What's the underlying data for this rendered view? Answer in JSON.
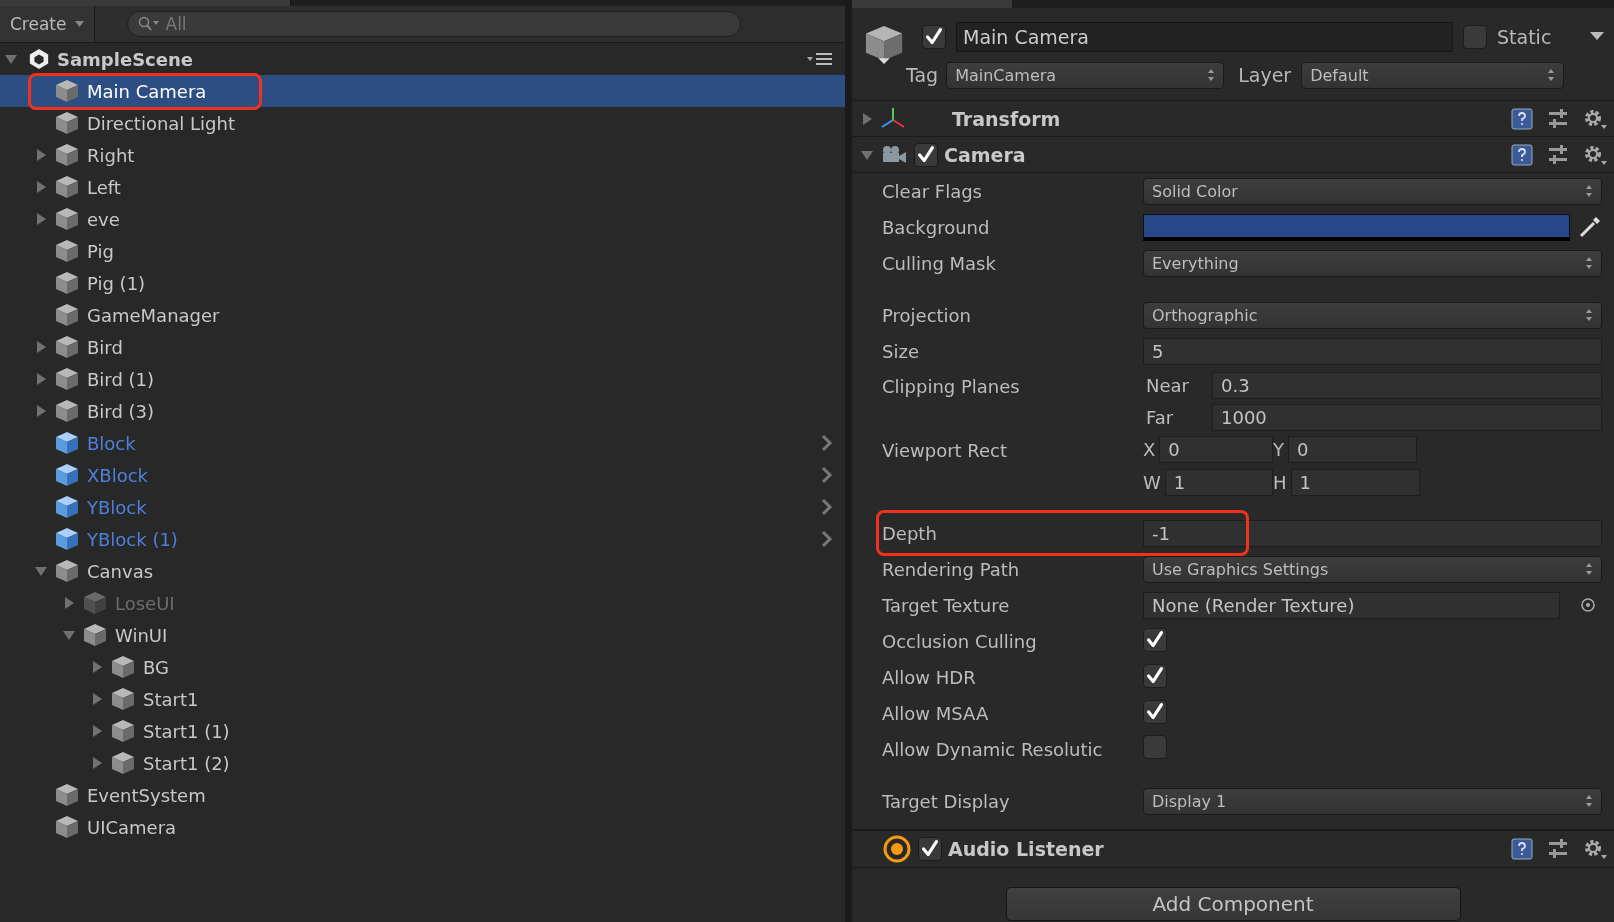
{
  "hierarchy": {
    "create_button": "Create",
    "search": {
      "placeholder": "All"
    },
    "scene": {
      "name": "SampleScene",
      "expanded": true,
      "children": [
        {
          "name": "Main Camera",
          "selected": true,
          "highlighted": true
        },
        {
          "name": "Directional Light",
          "selected": false
        },
        {
          "name": "Right",
          "selected": false,
          "expanded": false
        },
        {
          "name": "Left",
          "selected": false,
          "expanded": false
        },
        {
          "name": "eve",
          "selected": false,
          "expanded": false
        },
        {
          "name": "Pig",
          "selected": false
        },
        {
          "name": "Pig (1)",
          "selected": false
        },
        {
          "name": "GameManager",
          "selected": false
        },
        {
          "name": "Bird",
          "selected": false,
          "expanded": false
        },
        {
          "name": "Bird (1)",
          "selected": false,
          "expanded": false
        },
        {
          "name": "Bird (3)",
          "selected": false,
          "expanded": false
        },
        {
          "name": "Block",
          "selected": false,
          "prefab": true
        },
        {
          "name": "XBlock",
          "selected": false,
          "prefab": true
        },
        {
          "name": "YBlock",
          "selected": false,
          "prefab": true
        },
        {
          "name": "YBlock (1)",
          "selected": false,
          "prefab": true
        },
        {
          "name": "Canvas",
          "selected": false,
          "expanded": true,
          "children": [
            {
              "name": "LoseUI",
              "selected": false,
              "expanded": false,
              "active": false
            },
            {
              "name": "WinUI",
              "selected": false,
              "expanded": true,
              "children": [
                {
                  "name": "BG",
                  "selected": false,
                  "expanded": false
                },
                {
                  "name": "Start1",
                  "selected": false,
                  "expanded": false
                },
                {
                  "name": "Start1 (1)",
                  "selected": false,
                  "expanded": false
                },
                {
                  "name": "Start1 (2)",
                  "selected": false,
                  "expanded": false
                }
              ]
            }
          ]
        },
        {
          "name": "EventSystem",
          "selected": false
        },
        {
          "name": "UICamera",
          "selected": false
        }
      ]
    }
  },
  "inspector": {
    "object": {
      "active": true,
      "name": "Main Camera",
      "static": false,
      "static_label": "Static",
      "tag_label": "Tag",
      "tag": "MainCamera",
      "layer_label": "Layer",
      "layer": "Default"
    },
    "components": [
      {
        "kind": "transform",
        "name": "Transform",
        "expanded": false
      },
      {
        "kind": "camera",
        "name": "Camera",
        "enabled": true,
        "expanded": true,
        "properties": [
          {
            "kind": "dropdown",
            "label": "Clear Flags",
            "value": "Solid Color"
          },
          {
            "kind": "color",
            "label": "Background",
            "color": "#27478a"
          },
          {
            "kind": "dropdown",
            "label": "Culling Mask",
            "value": "Everything"
          },
          {
            "kind": "dropdown",
            "label": "Projection",
            "value": "Orthographic",
            "gap_before": true
          },
          {
            "kind": "number",
            "label": "Size",
            "value": "5"
          },
          {
            "kind": "pairs",
            "label": "Clipping Planes",
            "fields": [
              {
                "label": "Near",
                "value": "0.3"
              },
              {
                "label": "Far",
                "value": "1000"
              }
            ]
          },
          {
            "kind": "rect",
            "label": "Viewport Rect",
            "fields": [
              {
                "label": "X",
                "value": "0"
              },
              {
                "label": "Y",
                "value": "0"
              },
              {
                "label": "W",
                "value": "1"
              },
              {
                "label": "H",
                "value": "1"
              }
            ]
          },
          {
            "kind": "number",
            "label": "Depth",
            "value": "-1",
            "gap_before": true,
            "highlighted": true
          },
          {
            "kind": "dropdown",
            "label": "Rendering Path",
            "value": "Use Graphics Settings"
          },
          {
            "kind": "object",
            "label": "Target Texture",
            "value": "None (Render Texture)"
          },
          {
            "kind": "checkbox",
            "label": "Occlusion Culling",
            "checked": true
          },
          {
            "kind": "checkbox",
            "label": "Allow HDR",
            "checked": true
          },
          {
            "kind": "checkbox",
            "label": "Allow MSAA",
            "checked": true
          },
          {
            "kind": "checkbox",
            "label": "Allow Dynamic Resolutic",
            "checked": false
          },
          {
            "kind": "dropdown",
            "label": "Target Display",
            "value": "Display 1",
            "gap_before": true
          }
        ]
      },
      {
        "kind": "audio",
        "name": "Audio Listener",
        "enabled": true
      }
    ],
    "add_component": "Add Component"
  }
}
